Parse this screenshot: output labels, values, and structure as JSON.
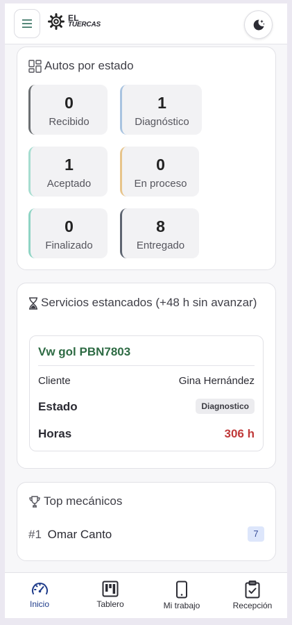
{
  "header": {
    "logo_line1": "EL",
    "logo_line2": "TUERCAS"
  },
  "status_card": {
    "title": "Autos por estado",
    "stats": [
      {
        "value": "0",
        "label": "Recibido",
        "color": "#6b6f72"
      },
      {
        "value": "1",
        "label": "Diagnóstico",
        "color": "#a8c3e0"
      },
      {
        "value": "1",
        "label": "Aceptado",
        "color": "#a6ddd0"
      },
      {
        "value": "0",
        "label": "En proceso",
        "color": "#e7c48a"
      },
      {
        "value": "0",
        "label": "Finalizado",
        "color": "#8fd4c4"
      },
      {
        "value": "8",
        "label": "Entregado",
        "color": "#5d6470"
      }
    ]
  },
  "stalled_card": {
    "title": "Servicios estancados (+48 h sin avanzar)",
    "service": {
      "vehicle": "Vw gol PBN7803",
      "client_label": "Cliente",
      "client_value": "Gina Hernández",
      "status_label": "Estado",
      "status_value": "Diagnostico",
      "hours_label": "Horas",
      "hours_value": "306 h"
    }
  },
  "mechanics_card": {
    "title": "Top mecánicos",
    "items": [
      {
        "rank": "#1",
        "name": "Omar Canto",
        "count": "7"
      }
    ]
  },
  "bottom_nav": [
    {
      "label": "Inicio",
      "icon": "gauge-icon",
      "active": true
    },
    {
      "label": "Tablero",
      "icon": "kanban-icon",
      "active": false
    },
    {
      "label": "Mi trabajo",
      "icon": "phone-icon",
      "active": false
    },
    {
      "label": "Recepción",
      "icon": "clipboard-check-icon",
      "active": false
    }
  ],
  "colors": {
    "accent": "#1e3b8a",
    "vehicle_green": "#2e6b44",
    "hours_red": "#c03a3a"
  }
}
